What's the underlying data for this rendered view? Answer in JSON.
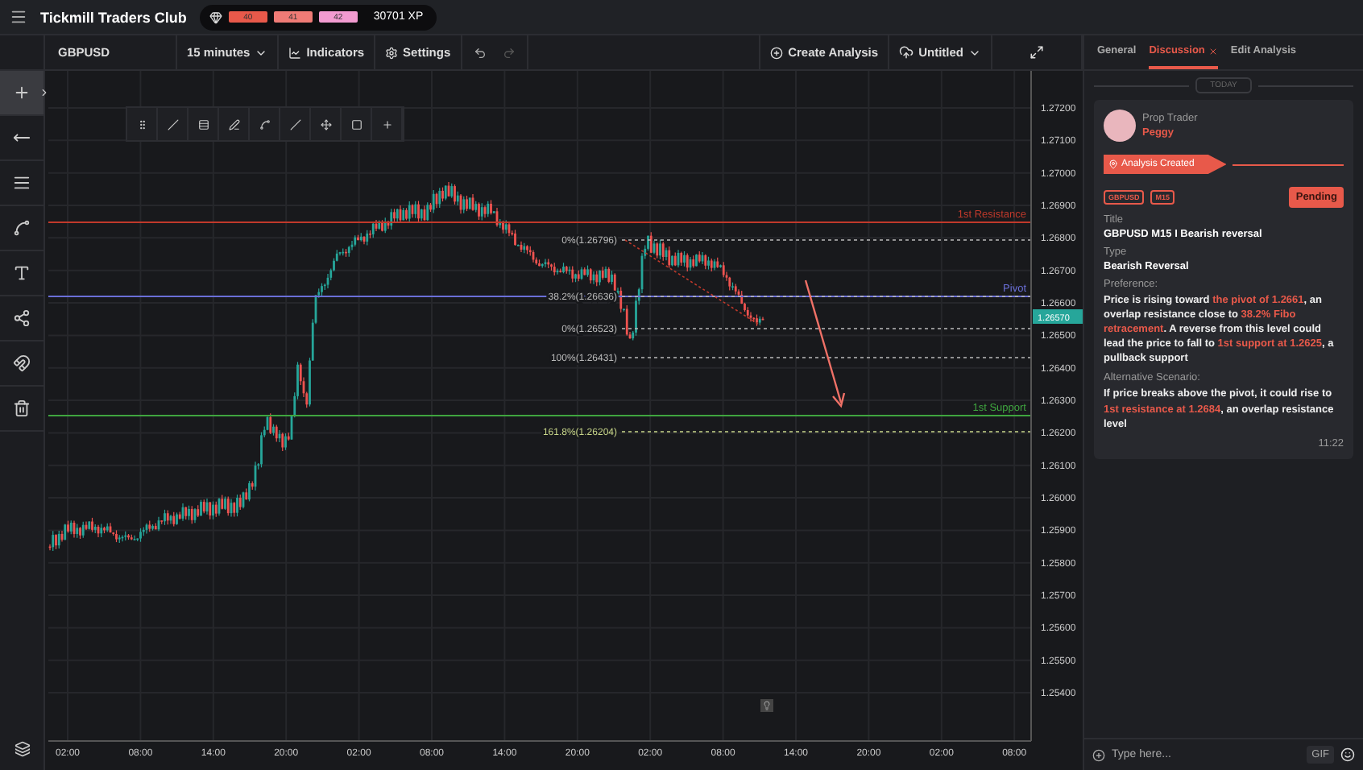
{
  "header": {
    "title": "Tickmill Traders Club",
    "levels": [
      {
        "label": "40",
        "color": "#e8594a"
      },
      {
        "label": "41",
        "color": "#ef7b76"
      },
      {
        "label": "42",
        "color": "#f29bd0"
      }
    ],
    "xp": "30701 XP"
  },
  "toolbar": {
    "symbol": "GBPUSD",
    "interval": "15 minutes",
    "indicators": "Indicators",
    "settings": "Settings",
    "create": "Create Analysis",
    "file": "Untitled"
  },
  "chart": {
    "price_ticks": [
      "1.27200",
      "1.27100",
      "1.27000",
      "1.26900",
      "1.26800",
      "1.26700",
      "1.26600",
      "1.26500",
      "1.26400",
      "1.26300",
      "1.26200",
      "1.26100",
      "1.26000",
      "1.25900",
      "1.25800",
      "1.25700",
      "1.25600",
      "1.25500",
      "1.25400"
    ],
    "current_price": "1.26570",
    "time_ticks": [
      "02:00",
      "08:00",
      "14:00",
      "20:00",
      "02:00",
      "08:00",
      "14:00",
      "20:00",
      "02:00",
      "08:00",
      "14:00",
      "20:00",
      "02:00",
      "08:00"
    ],
    "levels": [
      {
        "label": "1st Resistance",
        "kind": "resistance"
      },
      {
        "label": "Pivot",
        "kind": "pivot"
      },
      {
        "label": "1st Support",
        "kind": "support"
      }
    ],
    "fib_labels": [
      "0%(1.26796)",
      "38.2%(1.26636)",
      "0%(1.26523)",
      "100%(1.26431)",
      "161.8%(1.26204)"
    ]
  },
  "side_panel": {
    "tabs": [
      {
        "label": "General",
        "selected": false
      },
      {
        "label": "Discussion",
        "selected": true
      },
      {
        "label": "Edit Analysis",
        "selected": false
      }
    ],
    "day": "TODAY",
    "post": {
      "role": "Prop Trader",
      "author": "Peggy",
      "event": "Analysis Created",
      "tags": [
        "GBPUSD",
        "M15"
      ],
      "status": "Pending",
      "fields": [
        {
          "label": "Title",
          "value": "GBPUSD M15 I Bearish reversal"
        },
        {
          "label": "Type",
          "value": "Bearish Reversal"
        }
      ],
      "notes": [
        {
          "label": "Preference:",
          "text": [
            {
              "t": "Price is rising toward ",
              "hl": false
            },
            {
              "t": "the pivot of 1.2661",
              "hl": true
            },
            {
              "t": ", an overlap resistance close to ",
              "hl": false
            },
            {
              "t": "38.2% Fibo retracement",
              "hl": true
            },
            {
              "t": ". A reverse from this level could lead the price to fall to ",
              "hl": false
            },
            {
              "t": "1st support at 1.2625",
              "hl": true
            },
            {
              "t": ", a pullback support",
              "hl": false
            }
          ]
        },
        {
          "label": "Alternative Scenario:",
          "text": [
            {
              "t": "If price breaks above the pivot, it could rise to ",
              "hl": false
            },
            {
              "t": "1st resistance at 1.2684",
              "hl": true
            },
            {
              "t": ", an overlap resistance level",
              "hl": false
            }
          ]
        }
      ],
      "time": "11:22"
    },
    "composer": {
      "placeholder": "Type here...",
      "gif": "GIF"
    }
  }
}
